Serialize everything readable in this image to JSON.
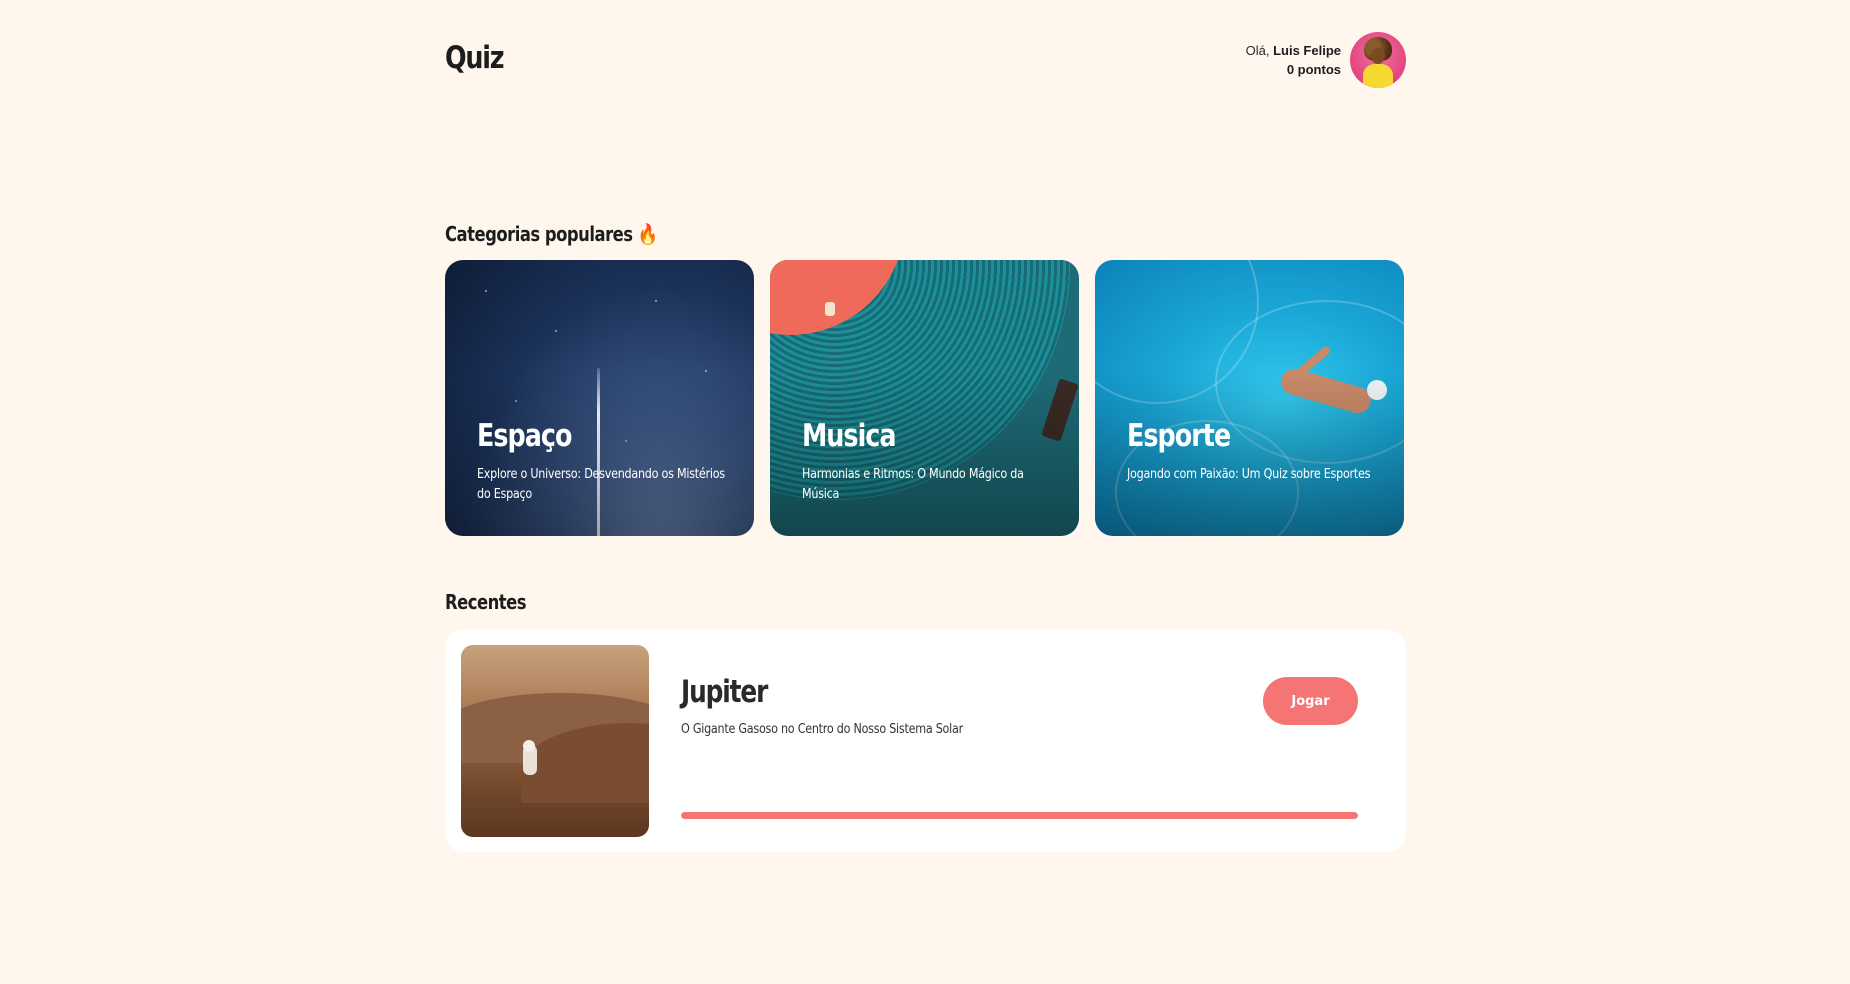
{
  "header": {
    "logo": "Quiz",
    "greeting": "Olá,",
    "user_name": "Luis Felipe",
    "points": "0 pontos",
    "avatar_icon": "user-avatar"
  },
  "popular": {
    "title": "Categorias populares",
    "title_emoji": "🔥",
    "cards": [
      {
        "title": "Espaço",
        "description": "Explore o Universo: Desvendando os Mistérios do Espaço"
      },
      {
        "title": "Musica",
        "description": "Harmonias e Ritmos: O Mundo Mágico da Música"
      },
      {
        "title": "Esporte",
        "description": "Jogando com Paixão: Um Quiz sobre Esportes"
      }
    ]
  },
  "recent": {
    "title": "Recentes",
    "item": {
      "title": "Jupiter",
      "description": "O Gigante Gasoso no Centro do Nosso Sistema Solar",
      "button_label": "Jogar",
      "progress_percent": 100
    }
  },
  "colors": {
    "background": "#fff6ee",
    "accent": "#f47574",
    "card_background": "#ffffff",
    "text": "#1d1d1d"
  }
}
